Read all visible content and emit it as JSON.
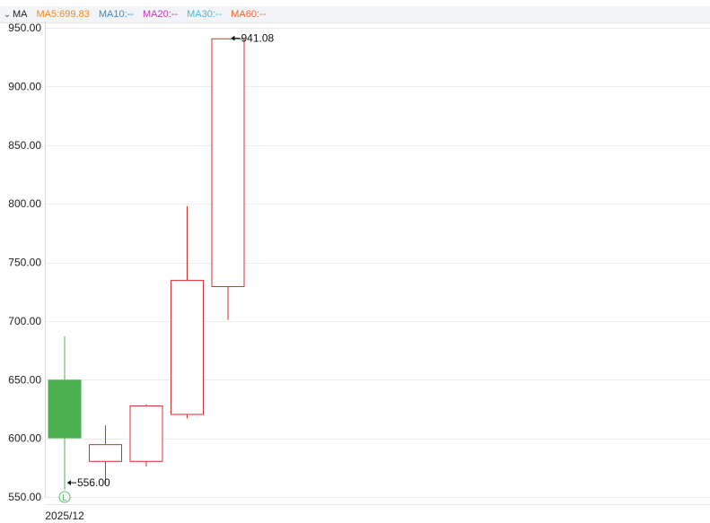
{
  "toolbar": {
    "chevron_icon": "chevron-down-icon",
    "label": "MA",
    "indicators": [
      {
        "text": "MA5:699.83",
        "color": "#f28a1a"
      },
      {
        "text": "MA10:--",
        "color": "#2f8fdb"
      },
      {
        "text": "MA20:--",
        "color": "#b83ab6"
      },
      {
        "text": "MA30:--",
        "color": "#3fbdd6"
      },
      {
        "text": "MA60:--",
        "color": "#f0642a"
      }
    ]
  },
  "chart_data": {
    "type": "candlestick",
    "title": "",
    "xlabel": "",
    "ylabel": "",
    "ylim": [
      550,
      950
    ],
    "yticks": [
      "950.00",
      "900.00",
      "850.00",
      "800.00",
      "750.00",
      "700.00",
      "650.00",
      "600.00",
      "550.00"
    ],
    "xticks": [
      {
        "index": 0,
        "label": "2025/12"
      }
    ],
    "grid": true,
    "up_color": "#d03030",
    "down_color": "#4caf50",
    "candles": [
      {
        "open": 650,
        "close": 600,
        "high": 687,
        "low": 556
      },
      {
        "open": 580,
        "close": 595,
        "high": 611,
        "low": 560
      },
      {
        "open": 580,
        "close": 628,
        "high": 629,
        "low": 576
      },
      {
        "open": 620,
        "close": 735,
        "high": 798,
        "low": 617
      },
      {
        "open": 729,
        "close": 941,
        "high": 941.08,
        "low": 701
      }
    ],
    "annotations": [
      {
        "candle": 4,
        "text": "941.08",
        "kind": "high"
      },
      {
        "candle": 0,
        "text": "556.00",
        "kind": "low"
      }
    ],
    "marker": {
      "candle": 0,
      "text": "L"
    }
  }
}
